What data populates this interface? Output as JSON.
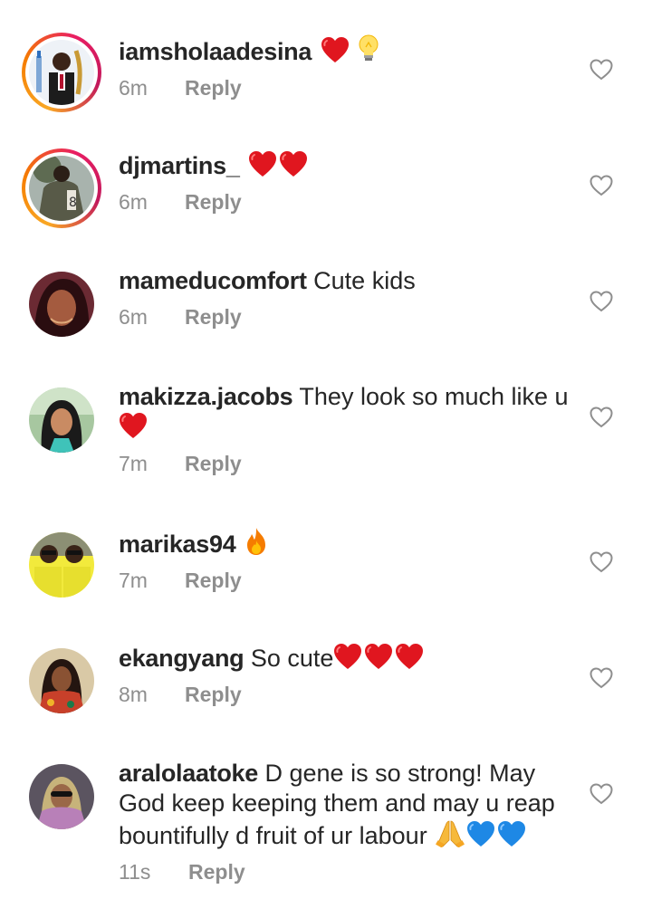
{
  "comments": [
    {
      "username": "iamsholaadesina",
      "text": "",
      "emojis": [
        "red-heart",
        "light-bulb"
      ],
      "time": "6m",
      "reply": "Reply"
    },
    {
      "username": "djmartins_",
      "text": "",
      "emojis": [
        "red-heart",
        "red-heart"
      ],
      "time": "6m",
      "reply": "Reply"
    },
    {
      "username": "mameducomfort",
      "text": "Cute kids",
      "emojis": [],
      "time": "6m",
      "reply": "Reply"
    },
    {
      "username": "makizza.jacobs",
      "text": "They look so much like u",
      "emojis": [
        "red-heart"
      ],
      "time": "7m",
      "reply": "Reply"
    },
    {
      "username": "marikas94",
      "text": "",
      "emojis": [
        "fire"
      ],
      "time": "7m",
      "reply": "Reply"
    },
    {
      "username": "ekangyang",
      "text": "So cute",
      "emojis": [
        "red-heart",
        "red-heart",
        "red-heart"
      ],
      "time": "8m",
      "reply": "Reply"
    },
    {
      "username": "aralolaatoke",
      "text": "D gene is so strong! May God keep keeping them and may u reap bountifully d fruit of ur labour",
      "emojis": [
        "folded-hands",
        "blue-heart",
        "blue-heart"
      ],
      "time": "11s",
      "reply": "Reply"
    }
  ],
  "colors": {
    "text": "#262626",
    "secondary": "#8e8e8e",
    "red_heart": "#e0161f",
    "blue_heart": "#1e88e5",
    "story_ring": "#e91e63"
  },
  "icons": {
    "like": "heart-outline-icon"
  }
}
